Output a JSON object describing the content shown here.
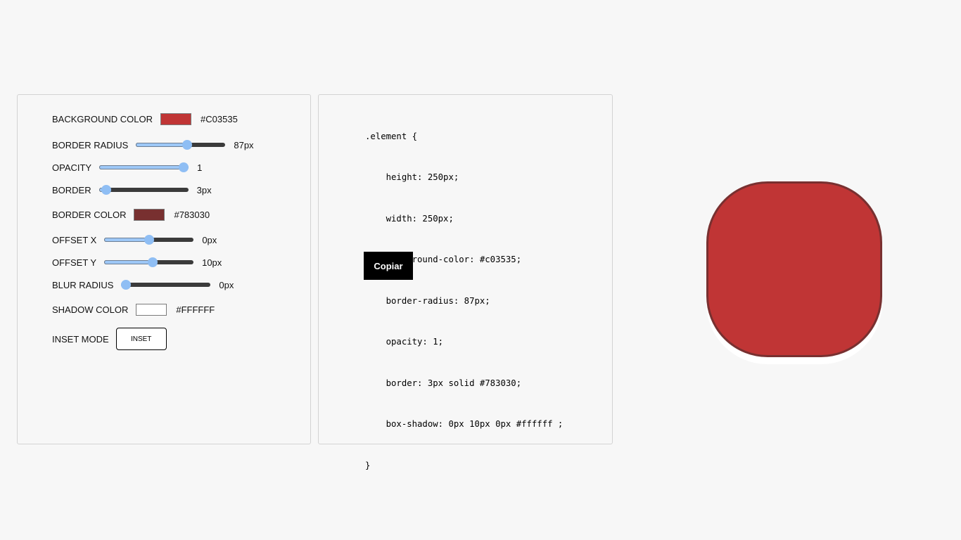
{
  "controls": {
    "background_color": {
      "label": "BACKGROUND COLOR",
      "value": "#C03535",
      "color": "#c03535"
    },
    "border_radius": {
      "label": "BORDER RADIUS",
      "value": "87px",
      "level": 0.58
    },
    "opacity": {
      "label": "OPACITY",
      "value": "1",
      "level": 1.0
    },
    "border": {
      "label": "BORDER",
      "value": "3px",
      "level": 0.03
    },
    "border_color": {
      "label": "BORDER COLOR",
      "value": "#783030",
      "color": "#783030"
    },
    "offset_x": {
      "label": "OFFSET X",
      "value": "0px",
      "level": 0.5
    },
    "offset_y": {
      "label": "OFFSET Y",
      "value": "10px",
      "level": 0.55
    },
    "blur_radius": {
      "label": "BLUR RADIUS",
      "value": "0px",
      "level": 0.0
    },
    "shadow_color": {
      "label": "SHADOW COLOR",
      "value": "#FFFFFF",
      "color": "#ffffff"
    },
    "inset_mode": {
      "label": "INSET MODE",
      "button_label": "INSET"
    }
  },
  "code": {
    "lines": [
      ".element {",
      "    height: 250px;",
      "    width: 250px;",
      "    background-color: #c03535;",
      "    border-radius: 87px;",
      "    opacity: 1;",
      "    border: 3px solid #783030;",
      "    box-shadow: 0px 10px 0px #ffffff ;",
      "}"
    ],
    "copy_label": "Copiar"
  },
  "preview": {
    "background_color": "#c03535",
    "border_color": "#783030",
    "shadow_color": "#ffffff"
  }
}
